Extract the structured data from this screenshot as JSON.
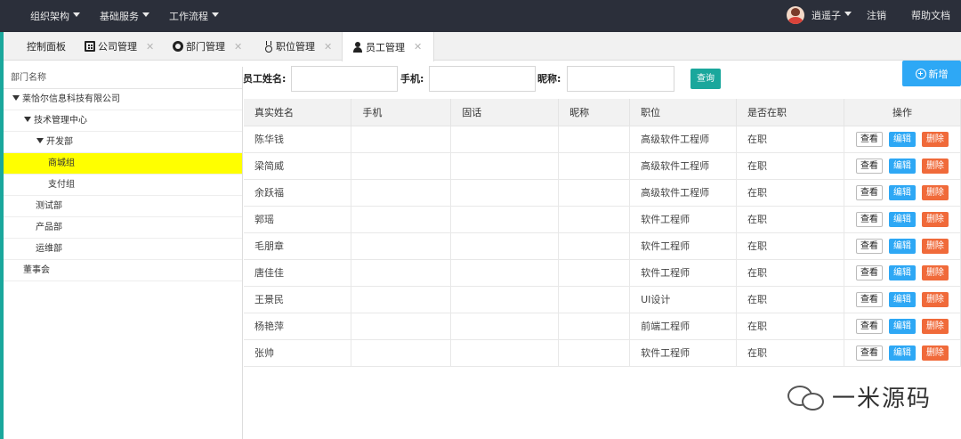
{
  "topbar": {
    "menu": [
      "组织架构",
      "基础服务",
      "工作流程"
    ],
    "user": "逍遥子",
    "logout": "注销",
    "help": "帮助文档"
  },
  "tabs": [
    {
      "label": "控制面板",
      "icon": "",
      "closable": false
    },
    {
      "label": "公司管理",
      "icon": "building-icon",
      "closable": true
    },
    {
      "label": "部门管理",
      "icon": "sitemap-icon",
      "closable": true
    },
    {
      "label": "职位管理",
      "icon": "medal-icon",
      "closable": true
    },
    {
      "label": "员工管理",
      "icon": "user-icon",
      "closable": true,
      "active": true
    }
  ],
  "tree": {
    "header": "部门名称",
    "nodes": [
      {
        "label": "莱恰尔信息科技有限公司",
        "expanded": true,
        "level": 0
      },
      {
        "label": "技术管理中心",
        "expanded": true,
        "level": 1
      },
      {
        "label": "开发部",
        "expanded": true,
        "level": 2
      },
      {
        "label": "商城组",
        "selected": true,
        "level": 3
      },
      {
        "label": "支付组",
        "level": 3
      },
      {
        "label": "测试部",
        "level": 2
      },
      {
        "label": "产品部",
        "level": 2
      },
      {
        "label": "运维部",
        "level": 2
      },
      {
        "label": "董事会",
        "level": 1
      }
    ]
  },
  "search": {
    "name_label": "员工姓名:",
    "name_value": "",
    "phone_label": "手机:",
    "phone_value": "",
    "nick_label": "昵称:",
    "nick_value": "",
    "query_button": "查询",
    "new_button": "新增"
  },
  "table": {
    "columns": [
      "真实姓名",
      "手机",
      "固话",
      "昵称",
      "职位",
      "是否在职",
      "操作"
    ],
    "actions": {
      "view": "查看",
      "edit": "编辑",
      "delete": "删除"
    },
    "rows": [
      {
        "name": "陈华钱",
        "mobile": "",
        "phone": "",
        "nick": "",
        "position": "高级软件工程师",
        "status": "在职"
      },
      {
        "name": "梁简威",
        "mobile": "",
        "phone": "",
        "nick": "",
        "position": "高级软件工程师",
        "status": "在职"
      },
      {
        "name": "余跃福",
        "mobile": "",
        "phone": "",
        "nick": "",
        "position": "高级软件工程师",
        "status": "在职"
      },
      {
        "name": "郭瑶",
        "mobile": "",
        "phone": "",
        "nick": "",
        "position": "软件工程师",
        "status": "在职"
      },
      {
        "name": "毛朋章",
        "mobile": "",
        "phone": "",
        "nick": "",
        "position": "软件工程师",
        "status": "在职"
      },
      {
        "name": "唐佳佳",
        "mobile": "",
        "phone": "",
        "nick": "",
        "position": "软件工程师",
        "status": "在职"
      },
      {
        "name": "王景民",
        "mobile": "",
        "phone": "",
        "nick": "",
        "position": "UI设计",
        "status": "在职"
      },
      {
        "name": "杨艳萍",
        "mobile": "",
        "phone": "",
        "nick": "",
        "position": "前端工程师",
        "status": "在职"
      },
      {
        "name": "张帅",
        "mobile": "",
        "phone": "",
        "nick": "",
        "position": "软件工程师",
        "status": "在职"
      }
    ]
  },
  "watermark": "一米源码"
}
